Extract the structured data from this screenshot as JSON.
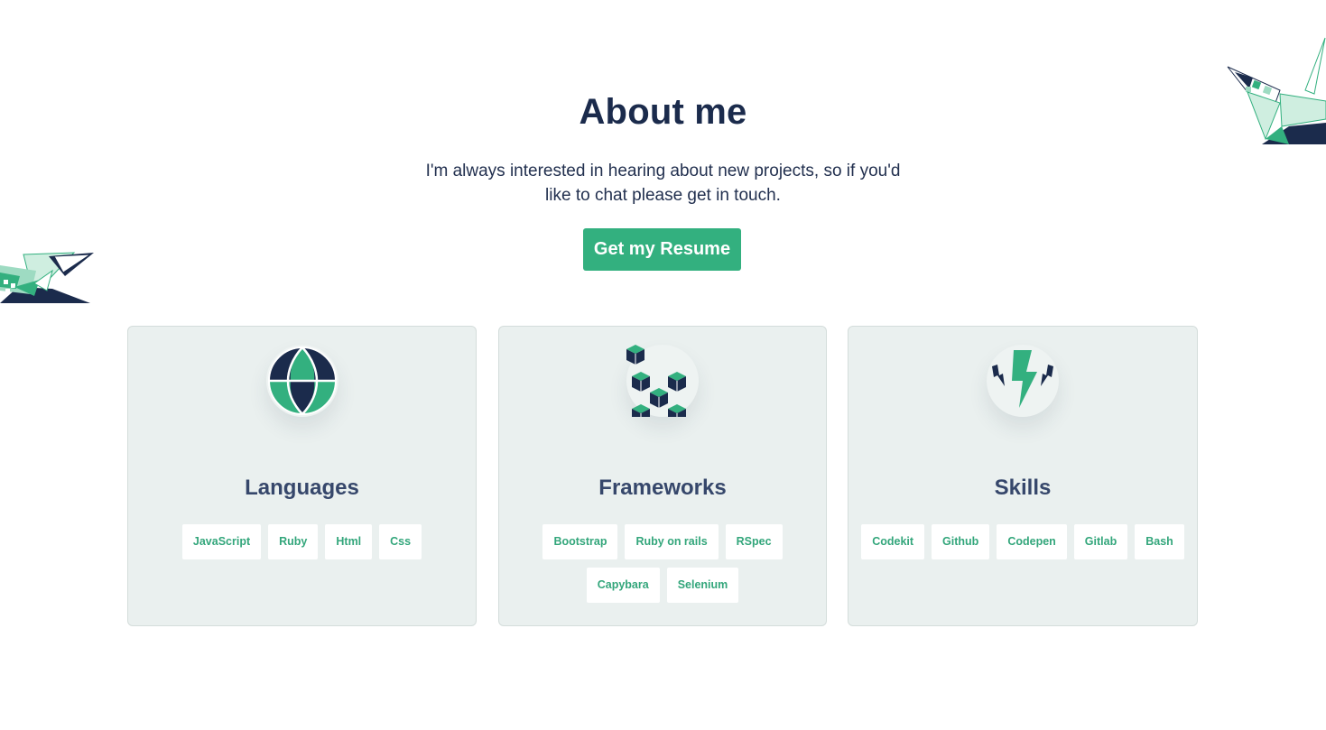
{
  "header": {
    "title": "About me",
    "subtitle_line1": "I'm always interested in hearing about new projects, so if you'd",
    "subtitle_line2": "like to chat please get in touch.",
    "resume_button": "Get my Resume"
  },
  "cards": [
    {
      "title": "Languages",
      "icon": "globe-icon",
      "tags": [
        "JavaScript",
        "Ruby",
        "Html",
        "Css"
      ]
    },
    {
      "title": "Frameworks",
      "icon": "cubes-icon",
      "tags": [
        "Bootstrap",
        "Ruby on rails",
        "RSpec",
        "Capybara",
        "Selenium"
      ]
    },
    {
      "title": "Skills",
      "icon": "lightning-icon",
      "tags": [
        "Codekit",
        "Github",
        "Codepen",
        "Gitlab",
        "Bash"
      ]
    }
  ],
  "colors": {
    "accent": "#33b07f",
    "navy": "#1b2b4c",
    "card_bg": "#eaf0ef"
  },
  "decorations": [
    "origami-crane-left",
    "origami-crane-right"
  ]
}
